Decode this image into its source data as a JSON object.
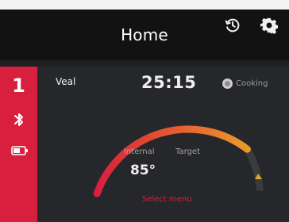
{
  "header": {
    "title": "Home",
    "icons": [
      "history-icon",
      "gear-icon"
    ]
  },
  "probe": {
    "number": "1",
    "icons": [
      "bluetooth-icon",
      "battery-icon"
    ]
  },
  "cook": {
    "meat": "Veal",
    "time": "25:15",
    "status": "Cooking",
    "internal_label": "Internal",
    "target_label": "Target",
    "internal_temp": "85°",
    "select_menu": "Select menu"
  },
  "colors": {
    "accent": "#d8203e",
    "gauge_start": "#d8203e",
    "gauge_end": "#e9a52a",
    "header_bg": "#121212",
    "panel_bg": "#26272a"
  }
}
